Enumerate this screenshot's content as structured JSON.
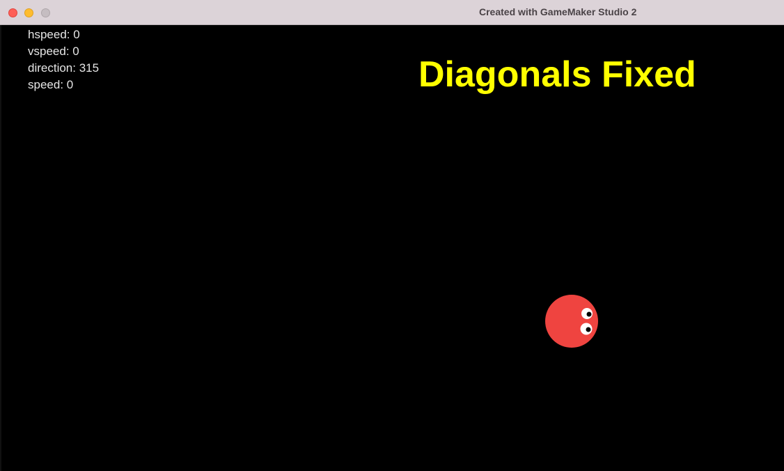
{
  "window": {
    "title": "Created with GameMaker Studio 2"
  },
  "debug": {
    "hspeed": "hspeed: 0",
    "vspeed": "vspeed: 0",
    "direction": "direction: 315",
    "speed": "speed: 0"
  },
  "headline": "Diagonals Fixed",
  "player": {
    "sprite": "red-ball-character-icon",
    "color": "#ef4440",
    "eye_color": "#ffffff",
    "pupil_color": "#000000"
  },
  "colors": {
    "background": "#000000",
    "headline": "#ffff00",
    "debug_text": "#e6e6e6"
  }
}
